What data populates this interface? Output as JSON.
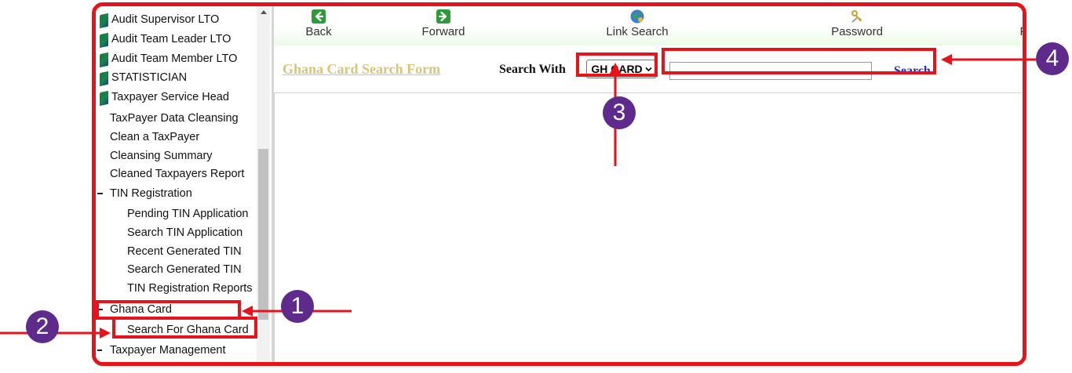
{
  "sidebar": {
    "roles": [
      {
        "label": "Audit Supervisor LTO"
      },
      {
        "label": "Audit Team Leader LTO"
      },
      {
        "label": "Audit Team Member LTO"
      },
      {
        "label": "STATISTICIAN"
      },
      {
        "label": "Taxpayer Service Head"
      }
    ],
    "data_cleansing_items": [
      {
        "label": "TaxPayer Data Cleansing"
      },
      {
        "label": "Clean a TaxPayer"
      },
      {
        "label": "Cleansing Summary"
      },
      {
        "label": "Cleaned Taxpayers Report"
      }
    ],
    "tin_registration": {
      "label": "TIN Registration",
      "children": [
        {
          "label": "Pending TIN Application"
        },
        {
          "label": "Search TIN Application"
        },
        {
          "label": "Recent Generated TIN"
        },
        {
          "label": "Search Generated TIN"
        },
        {
          "label": "TIN Registration Reports"
        }
      ]
    },
    "ghana_card": {
      "label": "Ghana Card",
      "children": [
        {
          "label": "Search For Ghana Card"
        }
      ]
    },
    "taxpayer_management": {
      "label": "Taxpayer Management"
    }
  },
  "toolbar": {
    "buttons": [
      {
        "label": "Back",
        "icon": "back-arrow-icon"
      },
      {
        "label": "Forward",
        "icon": "forward-arrow-icon"
      },
      {
        "label": "Link Search",
        "icon": "globe-icon"
      },
      {
        "label": "Password",
        "icon": "keys-icon"
      },
      {
        "label": "Pr"
      }
    ]
  },
  "form": {
    "title": "Ghana Card Search Form",
    "search_with_label": "Search With",
    "search_type": {
      "selected": "GH CARD"
    },
    "search_input": {
      "value": "",
      "placeholder": ""
    },
    "search_button": "Search"
  },
  "callouts": [
    "1",
    "2",
    "3",
    "4"
  ],
  "colors": {
    "highlight": "#e8121a",
    "callout": "#5e2a8c",
    "form_title": "#d6c57a",
    "search_link": "#2b2bb5",
    "toolbar_green": "#2d9b3a"
  }
}
